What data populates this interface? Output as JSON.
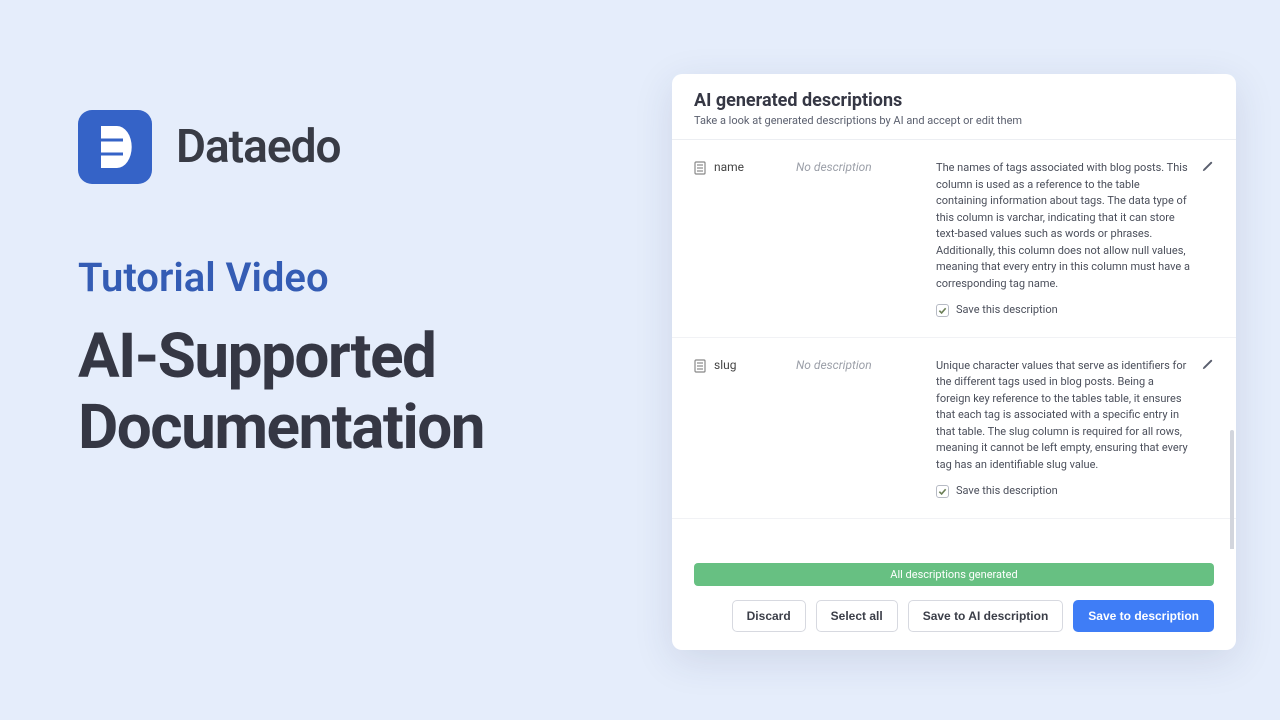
{
  "brand": {
    "name": "Dataedo"
  },
  "hero": {
    "kicker": "Tutorial Video",
    "title_line1": "AI-Supported",
    "title_line2": "Documentation"
  },
  "panel": {
    "title": "AI generated descriptions",
    "subtitle": "Take a look at generated descriptions by AI and accept or edit them",
    "no_description_placeholder": "No description",
    "save_checkbox_label": "Save this description",
    "columns": [
      {
        "name": "name",
        "ai_text": "The names of tags associated with blog posts. This column is used as a reference to the table containing information about tags. The data type of this column is varchar, indicating that it can store text-based values such as words or phrases. Additionally, this column does not allow null values, meaning that every entry in this column must have a corresponding tag name."
      },
      {
        "name": "slug",
        "ai_text": "Unique character values that serve as identifiers for the different tags used in blog posts. Being a foreign key reference to the tables table, it ensures that each tag is associated with a specific entry in that table. The slug column is required for all rows, meaning it cannot be left empty, ensuring that every tag has an identifiable slug value."
      }
    ],
    "status": "All descriptions generated",
    "buttons": {
      "discard": "Discard",
      "select_all": "Select all",
      "save_ai": "Save to AI description",
      "save_desc": "Save to description"
    }
  }
}
